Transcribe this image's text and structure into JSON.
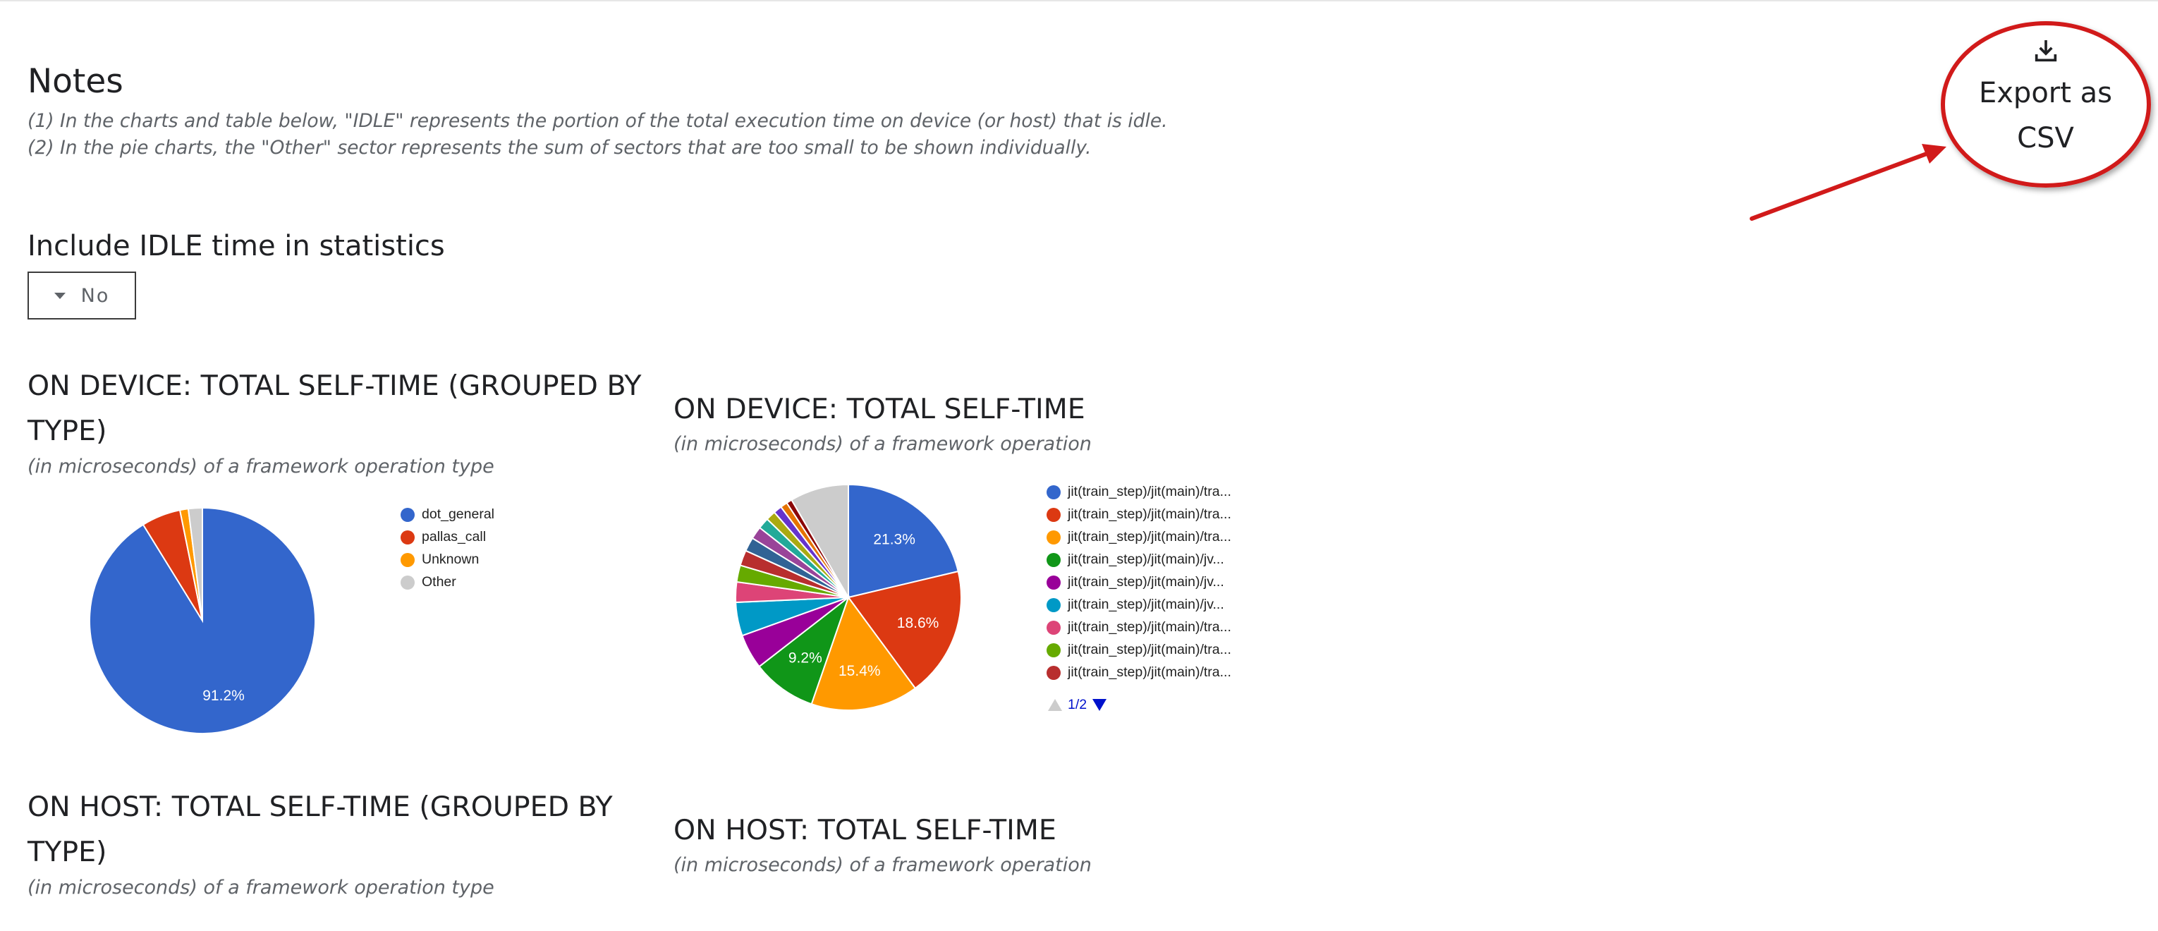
{
  "notes": {
    "heading": "Notes",
    "lines": [
      "(1) In the charts and table below, \"IDLE\" represents the portion of the total execution time on device (or host) that is idle.",
      "(2) In the pie charts, the \"Other\" sector represents the sum of sectors that are too small to be shown individually."
    ]
  },
  "idle_toggle": {
    "label": "Include IDLE time in statistics",
    "value": "No"
  },
  "export": {
    "label": "Export as CSV",
    "icon": "download-icon"
  },
  "sections": {
    "device_type": {
      "title": "ON DEVICE: TOTAL SELF-TIME (GROUPED BY TYPE)",
      "subtitle": "(in microseconds) of a framework operation type"
    },
    "device_op": {
      "title": "ON DEVICE: TOTAL SELF-TIME",
      "subtitle": "(in microseconds) of a framework operation"
    },
    "host_type": {
      "title": "ON HOST: TOTAL SELF-TIME (GROUPED BY TYPE)",
      "subtitle": "(in microseconds) of a framework operation type"
    },
    "host_op": {
      "title": "ON HOST: TOTAL SELF-TIME",
      "subtitle": "(in microseconds) of a framework operation"
    }
  },
  "chart_data": [
    {
      "type": "pie",
      "labels": [
        "dot_general",
        "pallas_call",
        "Unknown",
        "Other"
      ],
      "values": [
        91.2,
        5.6,
        1.2,
        2.0
      ],
      "colors": [
        "#3366cc",
        "#dc3912",
        "#ff9900",
        "#cccccc"
      ],
      "slice_labels": [
        "91.2%",
        "",
        "",
        ""
      ],
      "legend": "right"
    },
    {
      "type": "pie",
      "labels": [
        "jit(train_step)/jit(main)/tra...",
        "jit(train_step)/jit(main)/tra...",
        "jit(train_step)/jit(main)/tra...",
        "jit(train_step)/jit(main)/jv...",
        "jit(train_step)/jit(main)/jv...",
        "jit(train_step)/jit(main)/jv...",
        "jit(train_step)/jit(main)/tra...",
        "jit(train_step)/jit(main)/tra...",
        "jit(train_step)/jit(main)/tra...",
        "",
        "",
        "",
        "",
        "",
        "",
        "",
        ""
      ],
      "values": [
        21.3,
        18.6,
        15.4,
        9.2,
        5.0,
        4.8,
        2.9,
        2.4,
        2.2,
        2.0,
        1.8,
        1.6,
        1.4,
        1.2,
        1.0,
        0.8,
        8.4
      ],
      "colors": [
        "#3366cc",
        "#dc3912",
        "#ff9900",
        "#109618",
        "#990099",
        "#0099c6",
        "#dd4477",
        "#66aa00",
        "#b82e2e",
        "#316395",
        "#994499",
        "#22aa99",
        "#aaaa11",
        "#6633cc",
        "#e67300",
        "#8b0707",
        "#cccccc"
      ],
      "slice_labels": [
        "21.3%",
        "18.6%",
        "15.4%",
        "9.2%",
        "",
        "",
        "",
        "",
        "",
        "",
        "",
        "",
        "",
        "",
        "",
        "",
        ""
      ],
      "legend": "right",
      "page": "1/2"
    }
  ]
}
